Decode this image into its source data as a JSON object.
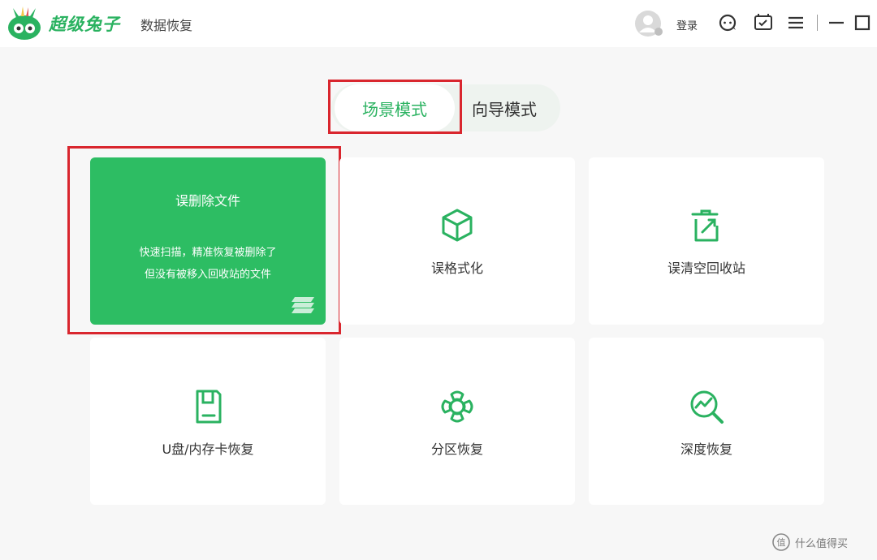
{
  "app": {
    "brand": "超级兔子",
    "product": "数据恢复",
    "login_label": "登录"
  },
  "tabs": [
    {
      "label": "场景模式",
      "active": true
    },
    {
      "label": "向导模式",
      "active": false
    }
  ],
  "cards": [
    {
      "title": "误删除文件",
      "desc_line1": "快速扫描，精准恢复被删除了",
      "desc_line2": "但没有被移入回收站的文件",
      "icon": "file-stack-icon",
      "active": true
    },
    {
      "label": "误格式化",
      "icon": "cube-icon"
    },
    {
      "label": "误清空回收站",
      "icon": "recycle-bin-icon"
    },
    {
      "label": "U盘/内存卡恢复",
      "icon": "sd-card-icon"
    },
    {
      "label": "分区恢复",
      "icon": "partition-icon"
    },
    {
      "label": "深度恢复",
      "icon": "deep-scan-icon"
    }
  ],
  "watermark": {
    "text": "什么值得买"
  },
  "colors": {
    "accent": "#2ab260",
    "card_active": "#2dbd63",
    "highlight_box": "#d9262e"
  }
}
